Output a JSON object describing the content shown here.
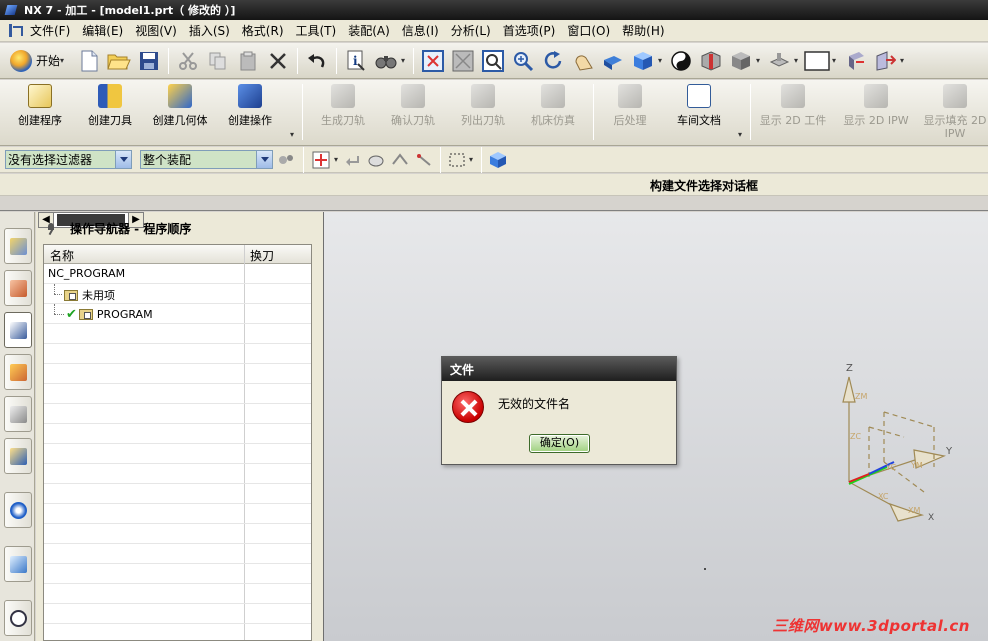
{
  "window": {
    "title": "NX 7 - 加工 - [model1.prt（ 修改的 ）]"
  },
  "menu": [
    "文件(F)",
    "编辑(E)",
    "视图(V)",
    "插入(S)",
    "格式(R)",
    "工具(T)",
    "装配(A)",
    "信息(I)",
    "分析(L)",
    "首选项(P)",
    "窗口(O)",
    "帮助(H)"
  ],
  "toolbar": {
    "start_label": "开始"
  },
  "manufacturing_toolbar": {
    "create_program": "创建程序",
    "create_tool": "创建刀具",
    "create_geometry": "创建几何体",
    "create_operation": "创建操作",
    "generate_path": "生成刀轨",
    "verify_path": "确认刀轨",
    "list_path": "列出刀轨",
    "machine_sim": "机床仿真",
    "postprocess": "后处理",
    "shop_doc": "车间文档",
    "show_2d_workpiece": "显示 2D 工件",
    "show_2d_ipw": "显示 2D IPW",
    "show_fill_2d_ipw": "显示填充 2D IPW"
  },
  "filters": {
    "selection_filter": "没有选择过滤器",
    "scope": "整个装配"
  },
  "cue_line": {
    "status": "构建文件选择对话框"
  },
  "navigator": {
    "title": "操作导航器 - 程序顺序",
    "columns": [
      "名称",
      "换刀"
    ],
    "rows": [
      {
        "name": "NC_PROGRAM"
      },
      {
        "name": "未用项"
      },
      {
        "name": "PROGRAM"
      }
    ]
  },
  "dialog": {
    "title": "文件",
    "message": "无效的文件名",
    "ok_label": "确定(O)"
  },
  "axes": {
    "z": "Z",
    "y": "Y",
    "x": "X",
    "zm": "ZM",
    "zc": "ZC",
    "ym": "YM",
    "xm": "XM",
    "yc": "YC",
    "xc": "XC"
  },
  "watermark": "三维网www.3dportal.cn",
  "colors": {
    "accent": "#345a9e",
    "combo_bg": "#cfe3c6",
    "error": "#c80000",
    "axis_tan": "#a08a55"
  }
}
